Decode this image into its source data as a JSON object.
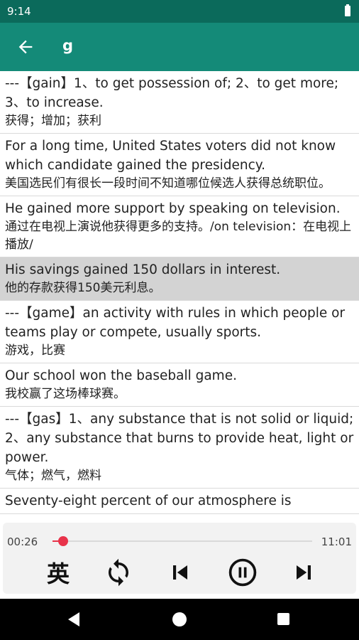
{
  "status": {
    "time": "9:14"
  },
  "header": {
    "title": "g",
    "back_icon": "arrow-left-icon"
  },
  "entries": [
    {
      "en": "---【gain】1、to get possession of; 2、to get more; 3、to increase.",
      "zh": "获得；增加；获利"
    },
    {
      "en": "For a long time, United States voters did not know which candidate gained the presidency.",
      "zh": "美国选民们有很长一段时间不知道哪位候选人获得总统职位。"
    },
    {
      "en": "He gained more support by speaking on television.",
      "zh": "通过在电视上演说他获得更多的支持。/on television：在电视上播放/"
    },
    {
      "en": "His savings gained 150 dollars in interest.",
      "zh": "他的存款获得150美元利息。",
      "highlighted": true
    },
    {
      "en": "---【game】an activity with rules in which people or teams play or compete, usually sports.",
      "zh": "游戏，比赛"
    },
    {
      "en": "Our school won the baseball game.",
      "zh": "我校赢了这场棒球赛。"
    },
    {
      "en": "---【gas】1、any substance that is not solid or liquid; 2、any substance that burns to provide heat, light or power.",
      "zh": "气体；燃气，燃料"
    },
    {
      "en": "Seventy-eight percent of our atmosphere is",
      "zh": ""
    }
  ],
  "player": {
    "current_time": "00:26",
    "total_time": "11:01",
    "progress": 0.04,
    "accent_color": "#e8334a",
    "lang_label": "英",
    "controls": [
      "lang-toggle",
      "repeat-icon",
      "skip-previous-icon",
      "pause-icon",
      "skip-next-icon"
    ]
  },
  "colors": {
    "status_bar": "#0b6a5b",
    "app_bar": "#148a78",
    "highlight": "#d3d3d3"
  }
}
